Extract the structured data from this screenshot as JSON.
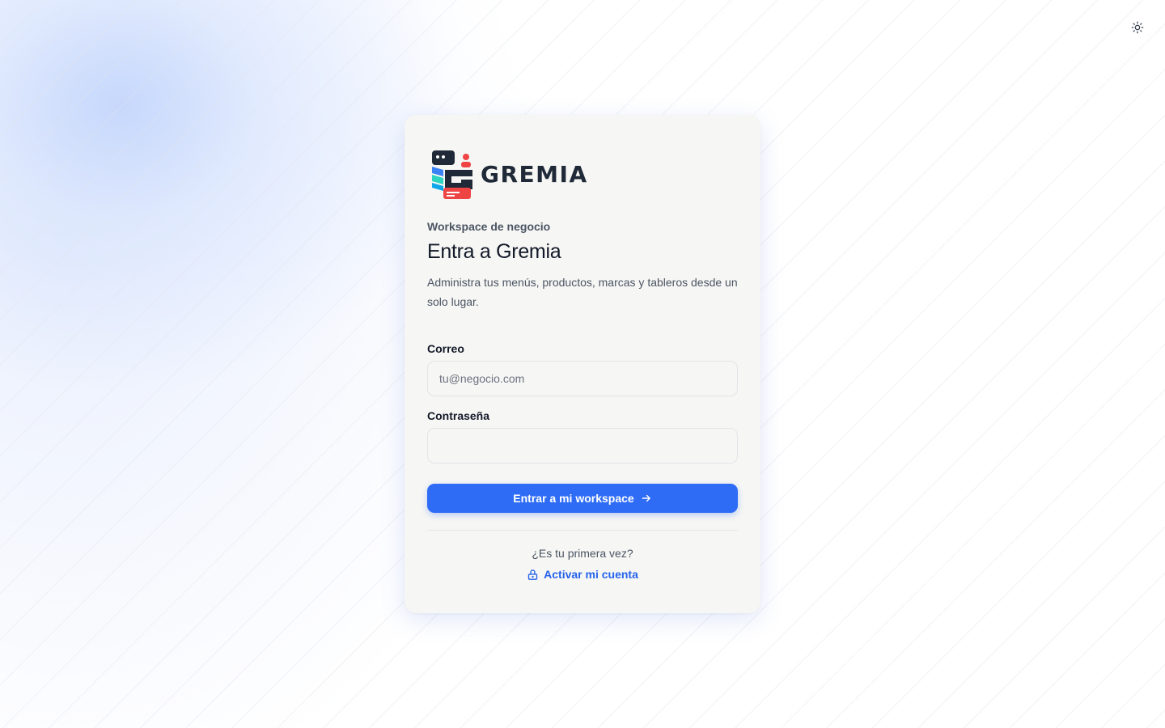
{
  "brand": {
    "name": "GREMIA",
    "logo_icon": "gremia-logo-icon",
    "colors": {
      "primary": "#2f6cf6",
      "link": "#2563eb",
      "dark": "#1f2937",
      "accent_red": "#ef4444",
      "accent_blue": "#3b82f6",
      "accent_teal": "#2dd4bf"
    }
  },
  "theme_toggle": {
    "icon": "sun-icon"
  },
  "login": {
    "eyebrow": "Workspace de negocio",
    "title": "Entra a Gremia",
    "subtitle": "Administra tus menús, productos, marcas y tableros desde un solo lugar.",
    "email": {
      "label": "Correo",
      "placeholder": "tu@negocio.com",
      "value": ""
    },
    "password": {
      "label": "Contraseña",
      "placeholder": "",
      "value": ""
    },
    "submit": {
      "label": "Entrar a mi workspace",
      "icon": "arrow-right-icon"
    },
    "first_time": "¿Es tu primera vez?",
    "activate": {
      "label": "Activar mi cuenta",
      "icon": "lock-icon"
    }
  }
}
